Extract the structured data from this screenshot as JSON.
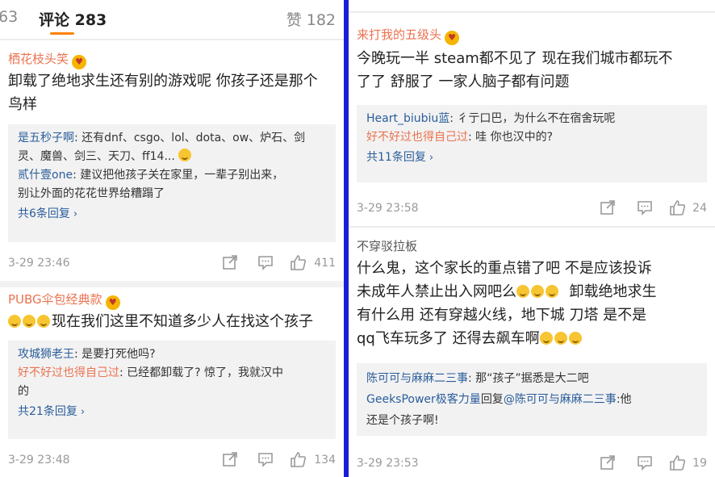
{
  "left": {
    "tabs": {
      "prev_count": "63",
      "active_label": "评论 283",
      "likes_label": "赞 182"
    },
    "comments": [
      {
        "user": "栖花枝头笑",
        "text_lines": [
          "卸载了绝地求生还有别的游戏呢 你孩子还是那个",
          "鸟样"
        ],
        "replies": [
          {
            "user": "是五秒子啊",
            "text_lines": [
              ": 还有dnf、csgo、lol、dota、ow、炉石、剑",
              "灵、魔兽、剑三、天刀、ff14..."
            ]
          },
          {
            "user": "贰什壹one",
            "text_lines": [
              ": 建议把他孩子关在家里，一辈子别出来，",
              "别让外面的花花世界给糟蹋了"
            ]
          }
        ],
        "more": "共6条回复",
        "time": "3-29 23:46",
        "likes": "411"
      },
      {
        "user": "PUBG伞包经典款",
        "text_lines": [
          "现在我们这里不知道多少人在找这个孩子"
        ],
        "replies": [
          {
            "user": "攻城狮老王",
            "text_lines": [
              ": 是要打死他吗?"
            ]
          },
          {
            "user": "好不好过也得自己过",
            "text_lines": [
              ": 已经都卸载了? 惊了，我就汉中",
              "的"
            ]
          }
        ],
        "more": "共21条回复",
        "time": "3-29 23:48",
        "likes": "134"
      }
    ]
  },
  "right": {
    "comments": [
      {
        "user": "来打我的五级头",
        "text_lines": [
          "今晚玩一半 steam都不见了 现在我们城市都玩不",
          "了了 舒服了 一家人脑子都有问题"
        ],
        "replies": [
          {
            "user": "Heart_biubiu蓝",
            "text_lines": [
              ": 彳亍口巴，为什么不在宿舍玩呢"
            ]
          },
          {
            "user": "好不好过也得自己过",
            "text_lines": [
              ": 哇 你也汉中的?"
            ]
          }
        ],
        "more": "共11条回复",
        "time": "3-29 23:58",
        "likes": "24"
      },
      {
        "user": "不穿驳拉板",
        "text_lines": [
          "什么鬼，这个家长的重点错了吧  不是应该投诉",
          "未成年人禁止出入网吧么",
          "卸载绝地求生",
          "有什么用 还有穿越火线，地下城  刀塔   是不是",
          "qq飞车玩多了 还得去飙车啊"
        ],
        "replies": [
          {
            "user": "陈可可与麻麻二三事",
            "text_lines": [
              ": 那“孩子”据悉是大二吧"
            ]
          },
          {
            "user": "GeeksPower极客力量",
            "text_lines": [
              "回复",
              "@陈可可与麻麻二三事",
              ":他",
              "还是个孩子啊!"
            ]
          }
        ],
        "time": "3-29 23:53",
        "likes": "19"
      }
    ]
  },
  "colors": {
    "username": "#eb7350",
    "link": "#2a5d9b",
    "divider": "#1a1fd6",
    "tab_underline": "#ff8200"
  }
}
